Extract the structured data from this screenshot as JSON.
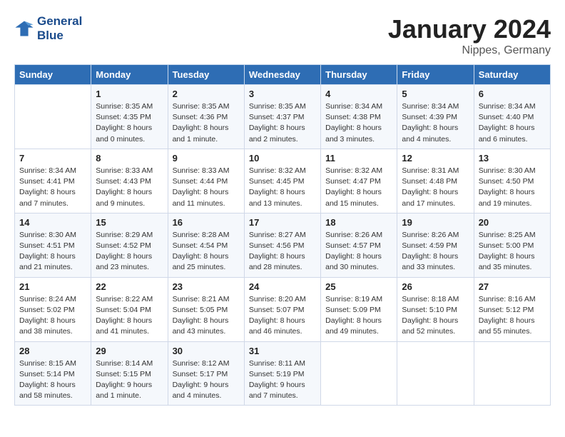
{
  "header": {
    "logo_line1": "General",
    "logo_line2": "Blue",
    "month": "January 2024",
    "location": "Nippes, Germany"
  },
  "weekdays": [
    "Sunday",
    "Monday",
    "Tuesday",
    "Wednesday",
    "Thursday",
    "Friday",
    "Saturday"
  ],
  "weeks": [
    [
      {
        "day": "",
        "info": ""
      },
      {
        "day": "1",
        "info": "Sunrise: 8:35 AM\nSunset: 4:35 PM\nDaylight: 8 hours\nand 0 minutes."
      },
      {
        "day": "2",
        "info": "Sunrise: 8:35 AM\nSunset: 4:36 PM\nDaylight: 8 hours\nand 1 minute."
      },
      {
        "day": "3",
        "info": "Sunrise: 8:35 AM\nSunset: 4:37 PM\nDaylight: 8 hours\nand 2 minutes."
      },
      {
        "day": "4",
        "info": "Sunrise: 8:34 AM\nSunset: 4:38 PM\nDaylight: 8 hours\nand 3 minutes."
      },
      {
        "day": "5",
        "info": "Sunrise: 8:34 AM\nSunset: 4:39 PM\nDaylight: 8 hours\nand 4 minutes."
      },
      {
        "day": "6",
        "info": "Sunrise: 8:34 AM\nSunset: 4:40 PM\nDaylight: 8 hours\nand 6 minutes."
      }
    ],
    [
      {
        "day": "7",
        "info": "Sunrise: 8:34 AM\nSunset: 4:41 PM\nDaylight: 8 hours\nand 7 minutes."
      },
      {
        "day": "8",
        "info": "Sunrise: 8:33 AM\nSunset: 4:43 PM\nDaylight: 8 hours\nand 9 minutes."
      },
      {
        "day": "9",
        "info": "Sunrise: 8:33 AM\nSunset: 4:44 PM\nDaylight: 8 hours\nand 11 minutes."
      },
      {
        "day": "10",
        "info": "Sunrise: 8:32 AM\nSunset: 4:45 PM\nDaylight: 8 hours\nand 13 minutes."
      },
      {
        "day": "11",
        "info": "Sunrise: 8:32 AM\nSunset: 4:47 PM\nDaylight: 8 hours\nand 15 minutes."
      },
      {
        "day": "12",
        "info": "Sunrise: 8:31 AM\nSunset: 4:48 PM\nDaylight: 8 hours\nand 17 minutes."
      },
      {
        "day": "13",
        "info": "Sunrise: 8:30 AM\nSunset: 4:50 PM\nDaylight: 8 hours\nand 19 minutes."
      }
    ],
    [
      {
        "day": "14",
        "info": "Sunrise: 8:30 AM\nSunset: 4:51 PM\nDaylight: 8 hours\nand 21 minutes."
      },
      {
        "day": "15",
        "info": "Sunrise: 8:29 AM\nSunset: 4:52 PM\nDaylight: 8 hours\nand 23 minutes."
      },
      {
        "day": "16",
        "info": "Sunrise: 8:28 AM\nSunset: 4:54 PM\nDaylight: 8 hours\nand 25 minutes."
      },
      {
        "day": "17",
        "info": "Sunrise: 8:27 AM\nSunset: 4:56 PM\nDaylight: 8 hours\nand 28 minutes."
      },
      {
        "day": "18",
        "info": "Sunrise: 8:26 AM\nSunset: 4:57 PM\nDaylight: 8 hours\nand 30 minutes."
      },
      {
        "day": "19",
        "info": "Sunrise: 8:26 AM\nSunset: 4:59 PM\nDaylight: 8 hours\nand 33 minutes."
      },
      {
        "day": "20",
        "info": "Sunrise: 8:25 AM\nSunset: 5:00 PM\nDaylight: 8 hours\nand 35 minutes."
      }
    ],
    [
      {
        "day": "21",
        "info": "Sunrise: 8:24 AM\nSunset: 5:02 PM\nDaylight: 8 hours\nand 38 minutes."
      },
      {
        "day": "22",
        "info": "Sunrise: 8:22 AM\nSunset: 5:04 PM\nDaylight: 8 hours\nand 41 minutes."
      },
      {
        "day": "23",
        "info": "Sunrise: 8:21 AM\nSunset: 5:05 PM\nDaylight: 8 hours\nand 43 minutes."
      },
      {
        "day": "24",
        "info": "Sunrise: 8:20 AM\nSunset: 5:07 PM\nDaylight: 8 hours\nand 46 minutes."
      },
      {
        "day": "25",
        "info": "Sunrise: 8:19 AM\nSunset: 5:09 PM\nDaylight: 8 hours\nand 49 minutes."
      },
      {
        "day": "26",
        "info": "Sunrise: 8:18 AM\nSunset: 5:10 PM\nDaylight: 8 hours\nand 52 minutes."
      },
      {
        "day": "27",
        "info": "Sunrise: 8:16 AM\nSunset: 5:12 PM\nDaylight: 8 hours\nand 55 minutes."
      }
    ],
    [
      {
        "day": "28",
        "info": "Sunrise: 8:15 AM\nSunset: 5:14 PM\nDaylight: 8 hours\nand 58 minutes."
      },
      {
        "day": "29",
        "info": "Sunrise: 8:14 AM\nSunset: 5:15 PM\nDaylight: 9 hours\nand 1 minute."
      },
      {
        "day": "30",
        "info": "Sunrise: 8:12 AM\nSunset: 5:17 PM\nDaylight: 9 hours\nand 4 minutes."
      },
      {
        "day": "31",
        "info": "Sunrise: 8:11 AM\nSunset: 5:19 PM\nDaylight: 9 hours\nand 7 minutes."
      },
      {
        "day": "",
        "info": ""
      },
      {
        "day": "",
        "info": ""
      },
      {
        "day": "",
        "info": ""
      }
    ]
  ]
}
